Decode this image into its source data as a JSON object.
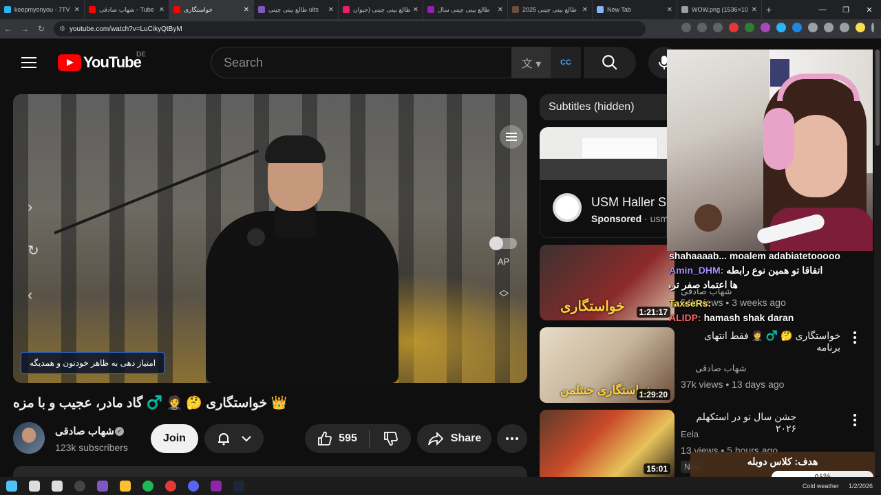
{
  "browser": {
    "tabs": [
      {
        "title": "keepmyonyou - 7TV",
        "color": "#29b6f6"
      },
      {
        "title": "شهاب صادقی - Tube",
        "color": "#ff0000"
      },
      {
        "title": "خواستگاری",
        "color": "#ff0000",
        "active": true
      },
      {
        "title": "طالع بینی چینی ults",
        "color": "#7e57c2"
      },
      {
        "title": "طالع بینی چینی (حیوان",
        "color": "#e91e63"
      },
      {
        "title": "طالع بینی چینی سال",
        "color": "#8e24aa"
      },
      {
        "title": "طالع بینی چینی 2025",
        "color": "#6d4c41"
      },
      {
        "title": "New Tab",
        "color": "#8ab4f8"
      },
      {
        "title": "WOW.png (1536×10",
        "color": "#9e9e9e"
      }
    ],
    "new_tab_symbol": "+",
    "url": "youtube.com/watch?v=LuCikyQtByM"
  },
  "youtube": {
    "logo_text": "YouTube",
    "country_code": "DE",
    "search_placeholder": "Search",
    "cc_label": "CC",
    "player": {
      "caption_overlay": "امتیاز دهی به ظاهر خودتون و همدیگه",
      "autoplay_label": "AP"
    },
    "video_title": "👑 خواستگاری 🤔 🤵 ♂️ گاد مادر، عجیب و با مزه",
    "channel": {
      "name": "شهاب صادقی",
      "subscribers": "123k subscribers",
      "join_label": "Join"
    },
    "actions": {
      "likes": "595",
      "share_label": "Share"
    },
    "sidebar": {
      "subtitles_chip": "Subtitles (hidden)",
      "ad": {
        "title": "USM Haller S",
        "sponsored": "Sponsored",
        "domain": "usm"
      },
      "videos": [
        {
          "title": "shahaaaab... moalem adabiatetooooo",
          "overlay": "خواستگاری",
          "duration": "1:21:17",
          "channel": "شهاب صادقی",
          "meta": "54k views • 3 weeks ago"
        },
        {
          "title": "خواستگاری 🤔 ♂️ 🤵 فقط انتهای برنامه",
          "overlay": "خواستگاری جنتلمن",
          "duration": "1:29:20",
          "channel": "شهاب صادقی",
          "meta": "37k views • 13 days ago"
        },
        {
          "title": "جشن سال نو در استکهلم ۲۰۲۶",
          "overlay": "",
          "duration": "15:01",
          "channel": "Eela",
          "meta": "13 views • 5 hours ago",
          "badge": "New"
        }
      ]
    }
  },
  "stream_overlay": {
    "chat": [
      {
        "user": "",
        "text": "shahaaaab... moalem adabiatetooooo"
      },
      {
        "user": "Amin_DHM:",
        "text": "اتفاقا تو همین نوع رابطه"
      },
      {
        "user": "",
        "text": "ها اعتماد صفر تره"
      },
      {
        "user": "TaxseRs:",
        "text": ""
      },
      {
        "user": "ALIDP:",
        "text": "hamash shak daran"
      }
    ],
    "goal_title": "هدف: کلاس دوبله",
    "goal_percent": "۵۶%",
    "goal_fraction": 0.56
  },
  "taskbar": {
    "apps": [
      "start",
      "search",
      "task-view",
      "obs",
      "vivaldi",
      "chrome",
      "spotify",
      "app-red",
      "discord",
      "app-r",
      "steam"
    ],
    "weather": "Cold weather",
    "date": "1/2/2026"
  }
}
